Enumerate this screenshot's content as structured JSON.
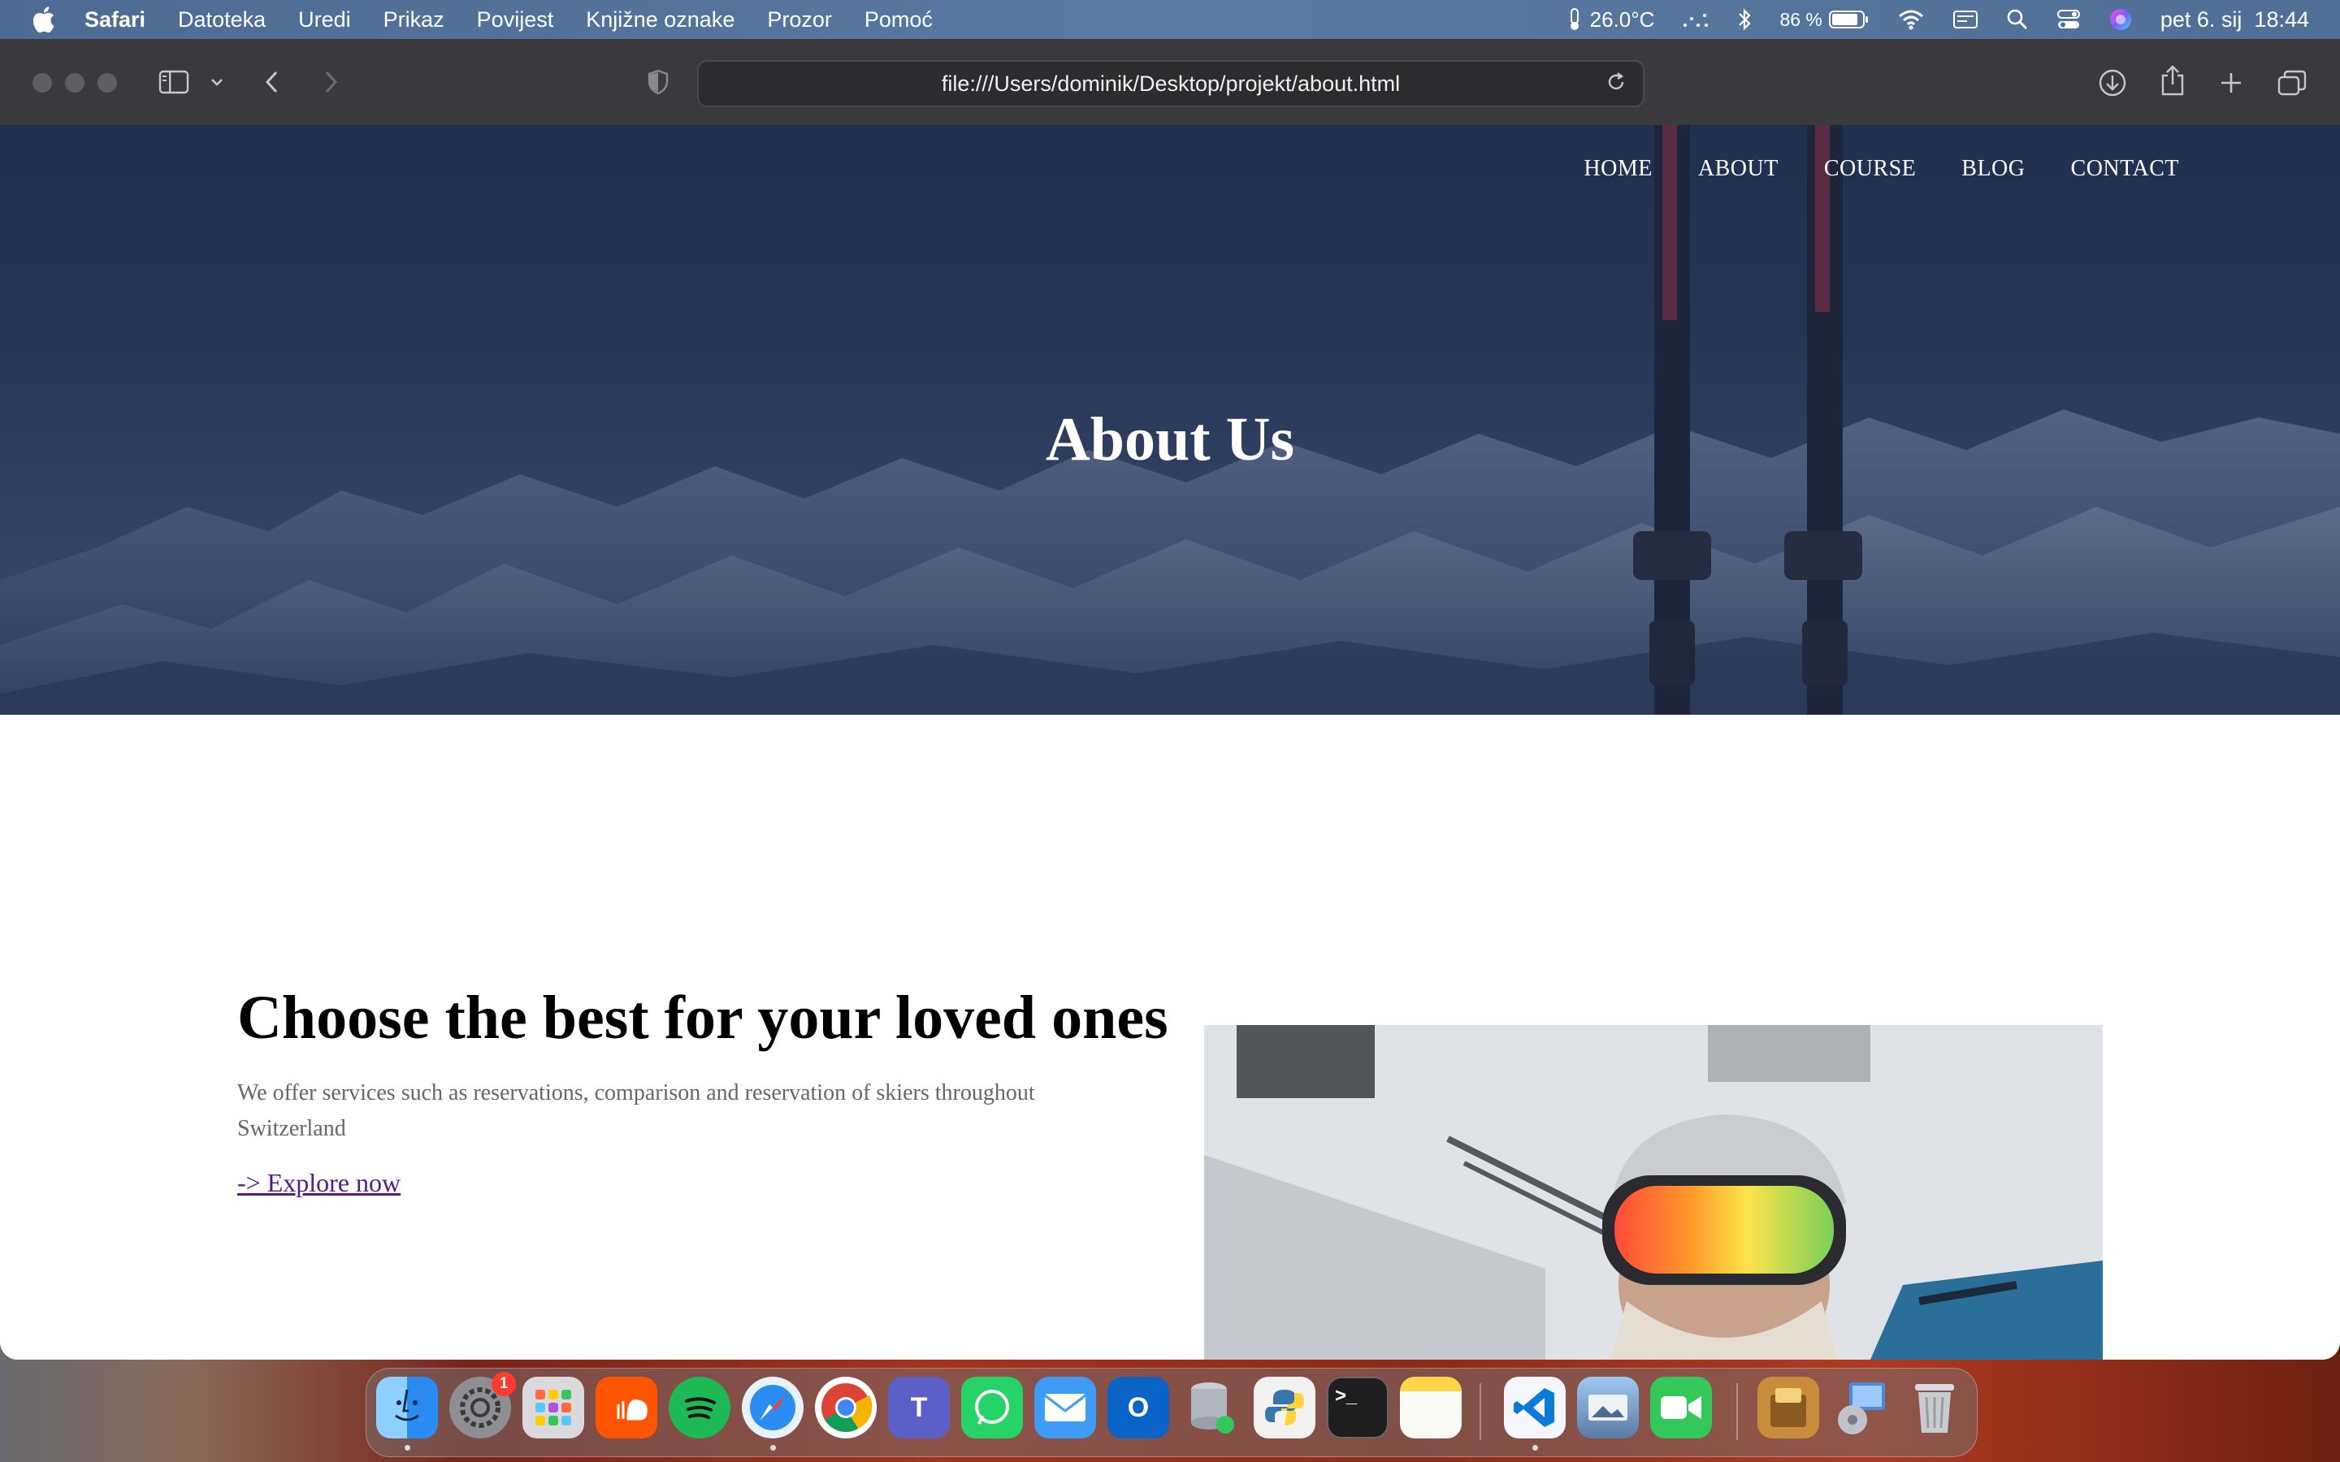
{
  "menubar": {
    "app_name": "Safari",
    "items": [
      "Datoteka",
      "Uredi",
      "Prikaz",
      "Povijest",
      "Knjižne oznake",
      "Prozor",
      "Pomoć"
    ],
    "temperature": "26.0°C",
    "battery": "86 %",
    "datetime": "pet 6. sij  18:44"
  },
  "browser": {
    "url": "file:///Users/dominik/Desktop/projekt/about.html"
  },
  "page": {
    "nav": [
      "HOME",
      "ABOUT",
      "COURSE",
      "BLOG",
      "CONTACT"
    ],
    "hero_title": "About Us",
    "heading": "Choose the best for your loved ones",
    "description": "We offer services such as reservations, comparison and reservation of skiers throughout Switzerland",
    "explore_link": "-> Explore now"
  },
  "dock": {
    "apps": [
      "finder",
      "system-settings",
      "launchpad",
      "soundcloud",
      "spotify",
      "safari",
      "chrome",
      "teams",
      "whatsapp",
      "mail",
      "outlook",
      "database",
      "python",
      "terminal",
      "notes",
      "vscode",
      "preview",
      "facetime",
      "sequel",
      "disk-utility",
      "trash"
    ],
    "settings_badge": "1"
  },
  "colors": {
    "menubar": "#4d6b92",
    "toolbar": "#3a3a3c",
    "hero_overlay": "#2c3d5e",
    "link_visited": "#551a8b"
  }
}
